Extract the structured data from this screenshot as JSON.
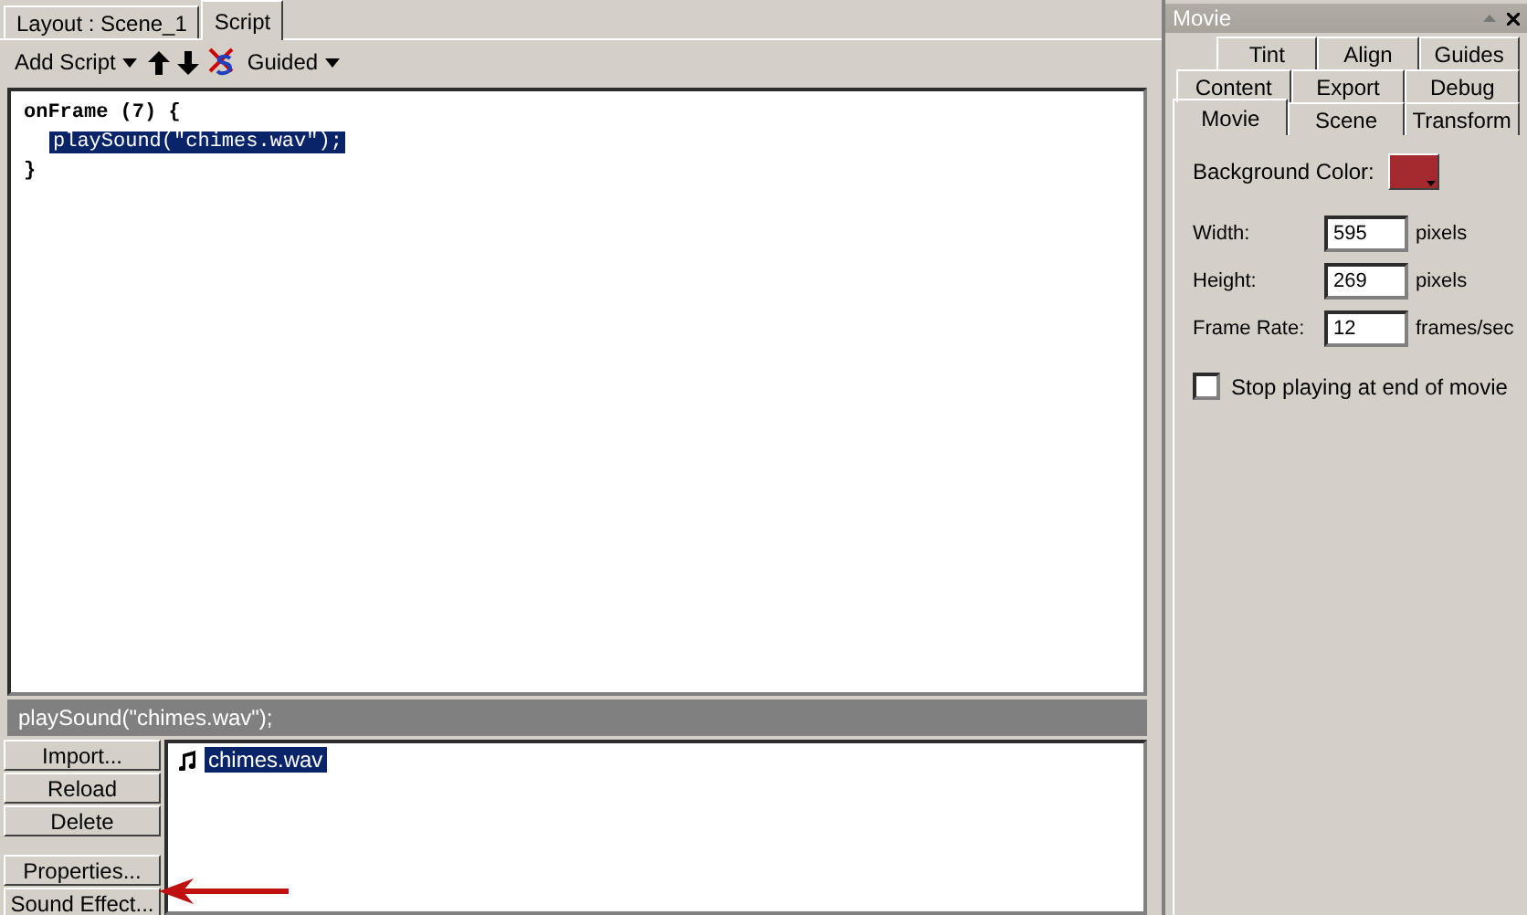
{
  "tabs": [
    {
      "label": "Layout : Scene_1",
      "selected": false
    },
    {
      "label": "Script",
      "selected": true
    }
  ],
  "toolbar": {
    "add_script": "Add Script",
    "guided": "Guided"
  },
  "code": [
    {
      "text": "onFrame (7) {",
      "selected": false,
      "children": [
        {
          "text": "playSound(\"chimes.wav\");",
          "selected": true
        }
      ]
    },
    {
      "text": "}",
      "selected": false
    }
  ],
  "status_line": "playSound(\"chimes.wav\");",
  "button_groups": [
    [
      "Import...",
      "Reload",
      "Delete"
    ],
    [
      "Properties...",
      "Sound Effect..."
    ]
  ],
  "sounds": [
    {
      "name": "chimes.wav",
      "selected": true
    }
  ],
  "panel": {
    "title": "Movie",
    "tab_rows": [
      [
        {
          "label": "Tint",
          "selected": false
        },
        {
          "label": "Align",
          "selected": false
        },
        {
          "label": "Guides",
          "selected": false
        }
      ],
      [
        {
          "label": "Content",
          "selected": false
        },
        {
          "label": "Export",
          "selected": false
        },
        {
          "label": "Debug",
          "selected": false
        }
      ],
      [
        {
          "label": "Movie",
          "selected": true
        },
        {
          "label": "Scene",
          "selected": false
        },
        {
          "label": "Transform",
          "selected": false
        }
      ]
    ],
    "background_color": {
      "label": "Background Color:",
      "color": "#a52a30"
    },
    "fields": [
      {
        "label": "Width:",
        "value": "595",
        "unit": "pixels"
      },
      {
        "label": "Height:",
        "value": "269",
        "unit": "pixels"
      },
      {
        "label": "Frame Rate:",
        "value": "12",
        "unit": "frames/sec"
      }
    ],
    "checkbox": {
      "label": "Stop playing at end of movie",
      "checked": false
    }
  }
}
